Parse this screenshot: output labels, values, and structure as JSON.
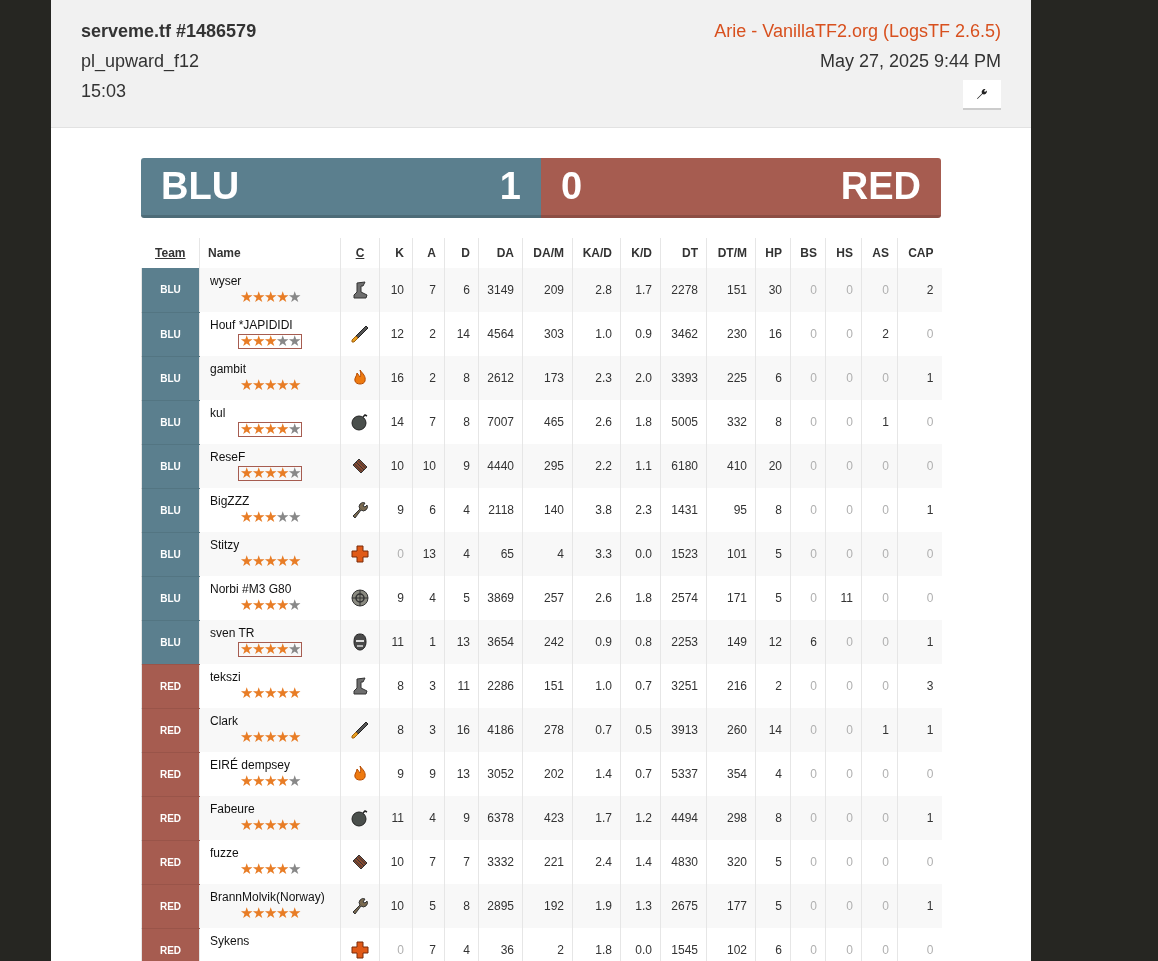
{
  "header": {
    "server": "serveme.tf #1486579",
    "map": "pl_upward_f12",
    "duration": "15:03",
    "uploader": "Arie - VanillaTF2.org (LogsTF 2.6.5)",
    "date": "May 27, 2025 9:44 PM"
  },
  "score": {
    "blu_label": "BLU",
    "blu_score": "1",
    "red_score": "0",
    "red_label": "RED"
  },
  "columns": [
    {
      "label": "Team",
      "sortable": true
    },
    {
      "label": "Name",
      "sortable": false
    },
    {
      "label": "C",
      "sortable": true
    },
    {
      "label": "K",
      "sortable": false
    },
    {
      "label": "A",
      "sortable": false
    },
    {
      "label": "D",
      "sortable": false
    },
    {
      "label": "DA",
      "sortable": false
    },
    {
      "label": "DA/M",
      "sortable": false
    },
    {
      "label": "KA/D",
      "sortable": false
    },
    {
      "label": "K/D",
      "sortable": false
    },
    {
      "label": "DT",
      "sortable": false
    },
    {
      "label": "DT/M",
      "sortable": false
    },
    {
      "label": "HP",
      "sortable": false
    },
    {
      "label": "BS",
      "sortable": false
    },
    {
      "label": "HS",
      "sortable": false
    },
    {
      "label": "AS",
      "sortable": false
    },
    {
      "label": "CAP",
      "sortable": false
    }
  ],
  "rows": [
    {
      "team": "BLU",
      "color": "#5b7f8e",
      "name": "wyser",
      "stars": 4,
      "boxed": false,
      "kind": "scout",
      "stats": [
        "10",
        "7",
        "6",
        "3149",
        "209",
        "2.8",
        "1.7",
        "2278",
        "151",
        "30",
        "0",
        "0",
        "0",
        "2"
      ]
    },
    {
      "team": "BLU",
      "color": "#5b7f8e",
      "name": "Houf *JAPIDIDI",
      "stars": 3,
      "boxed": true,
      "kind": "soldier",
      "stats": [
        "12",
        "2",
        "14",
        "4564",
        "303",
        "1.0",
        "0.9",
        "3462",
        "230",
        "16",
        "0",
        "0",
        "2",
        "0"
      ]
    },
    {
      "team": "BLU",
      "color": "#5b7f8e",
      "name": "gambit",
      "stars": 5,
      "boxed": false,
      "kind": "pyro",
      "stats": [
        "16",
        "2",
        "8",
        "2612",
        "173",
        "2.3",
        "2.0",
        "3393",
        "225",
        "6",
        "0",
        "0",
        "0",
        "1"
      ]
    },
    {
      "team": "BLU",
      "color": "#5b7f8e",
      "name": "kul",
      "stars": 4,
      "boxed": true,
      "kind": "demoman",
      "stats": [
        "14",
        "7",
        "8",
        "7007",
        "465",
        "2.6",
        "1.8",
        "5005",
        "332",
        "8",
        "0",
        "0",
        "1",
        "0"
      ]
    },
    {
      "team": "BLU",
      "color": "#5b7f8e",
      "name": "ReseF",
      "stars": 4,
      "boxed": true,
      "kind": "heavy",
      "stats": [
        "10",
        "10",
        "9",
        "4440",
        "295",
        "2.2",
        "1.1",
        "6180",
        "410",
        "20",
        "0",
        "0",
        "0",
        "0"
      ]
    },
    {
      "team": "BLU",
      "color": "#5b7f8e",
      "name": "BigZZZ",
      "stars": 3,
      "boxed": false,
      "kind": "engineer",
      "stats": [
        "9",
        "6",
        "4",
        "2118",
        "140",
        "3.8",
        "2.3",
        "1431",
        "95",
        "8",
        "0",
        "0",
        "0",
        "1"
      ]
    },
    {
      "team": "BLU",
      "color": "#5b7f8e",
      "name": "Stitzy",
      "stars": 5,
      "boxed": false,
      "kind": "medic",
      "stats": [
        "0",
        "13",
        "4",
        "65",
        "4",
        "3.3",
        "0.0",
        "1523",
        "101",
        "5",
        "0",
        "0",
        "0",
        "0"
      ]
    },
    {
      "team": "BLU",
      "color": "#5b7f8e",
      "name": "Norbi #M3 G80",
      "stars": 4,
      "boxed": false,
      "kind": "sniper",
      "stats": [
        "9",
        "4",
        "5",
        "3869",
        "257",
        "2.6",
        "1.8",
        "2574",
        "171",
        "5",
        "0",
        "11",
        "0",
        "0"
      ]
    },
    {
      "team": "BLU",
      "color": "#5b7f8e",
      "name": "sven TR",
      "stars": 4,
      "boxed": true,
      "kind": "spy",
      "stats": [
        "11",
        "1",
        "13",
        "3654",
        "242",
        "0.9",
        "0.8",
        "2253",
        "149",
        "12",
        "6",
        "0",
        "0",
        "1"
      ]
    },
    {
      "team": "RED",
      "color": "#a65c50",
      "name": "tekszi",
      "stars": 5,
      "boxed": false,
      "kind": "scout",
      "stats": [
        "8",
        "3",
        "11",
        "2286",
        "151",
        "1.0",
        "0.7",
        "3251",
        "216",
        "2",
        "0",
        "0",
        "0",
        "3"
      ]
    },
    {
      "team": "RED",
      "color": "#a65c50",
      "name": "Clark",
      "stars": 5,
      "boxed": false,
      "kind": "soldier",
      "stats": [
        "8",
        "3",
        "16",
        "4186",
        "278",
        "0.7",
        "0.5",
        "3913",
        "260",
        "14",
        "0",
        "0",
        "1",
        "1"
      ]
    },
    {
      "team": "RED",
      "color": "#a65c50",
      "name": "EIRÉ dempsey",
      "stars": 4,
      "boxed": false,
      "kind": "pyro",
      "stats": [
        "9",
        "9",
        "13",
        "3052",
        "202",
        "1.4",
        "0.7",
        "5337",
        "354",
        "4",
        "0",
        "0",
        "0",
        "0"
      ]
    },
    {
      "team": "RED",
      "color": "#a65c50",
      "name": "Fabeure",
      "stars": 5,
      "boxed": false,
      "kind": "demoman",
      "stats": [
        "11",
        "4",
        "9",
        "6378",
        "423",
        "1.7",
        "1.2",
        "4494",
        "298",
        "8",
        "0",
        "0",
        "0",
        "1"
      ]
    },
    {
      "team": "RED",
      "color": "#a65c50",
      "name": "fuzze",
      "stars": 4,
      "boxed": false,
      "kind": "heavy",
      "stats": [
        "10",
        "7",
        "7",
        "3332",
        "221",
        "2.4",
        "1.4",
        "4830",
        "320",
        "5",
        "0",
        "0",
        "0",
        "0"
      ]
    },
    {
      "team": "RED",
      "color": "#a65c50",
      "name": "BrannMolvik(Norway)",
      "stars": 5,
      "boxed": false,
      "kind": "engineer",
      "stats": [
        "10",
        "5",
        "8",
        "2895",
        "192",
        "1.9",
        "1.3",
        "2675",
        "177",
        "5",
        "0",
        "0",
        "0",
        "1"
      ]
    },
    {
      "team": "RED",
      "color": "#a65c50",
      "name": "Sykens",
      "kind": "medic",
      "stats": [
        "0",
        "7",
        "4",
        "36",
        "2",
        "1.8",
        "0.0",
        "1545",
        "102",
        "6",
        "0",
        "0",
        "0",
        "0"
      ]
    }
  ]
}
